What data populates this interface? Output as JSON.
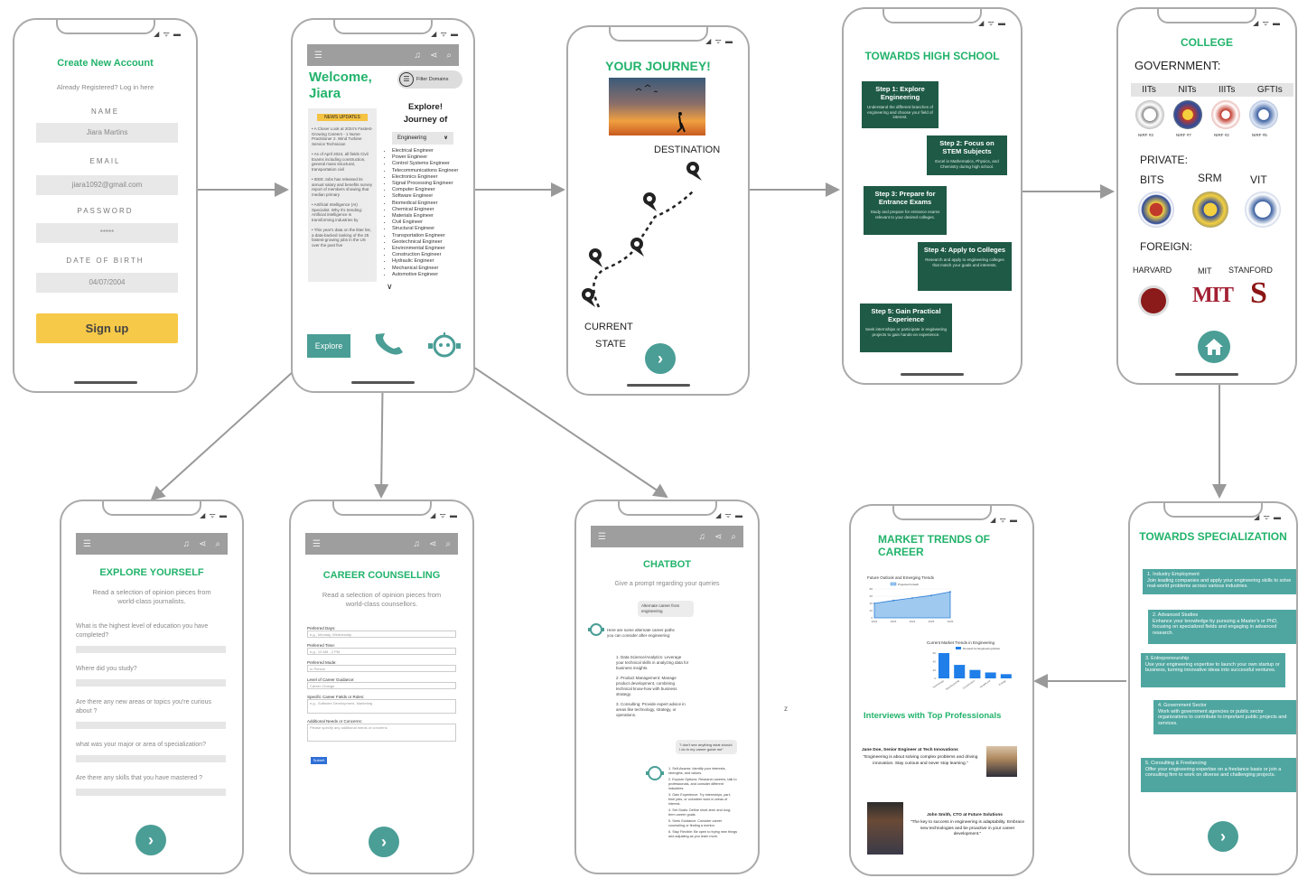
{
  "status_icons": "◢ ᯤ ▬",
  "signup": {
    "title": "Create New Account",
    "subtitle": "Already Registered? Log in here",
    "name_label": "NAME",
    "name_value": "Jiara Martins",
    "email_label": "EMAIL",
    "email_value": "jiara1092@gmail.com",
    "password_label": "PASSWORD",
    "password_value": "*****",
    "dob_label": "DATE OF BIRTH",
    "dob_value": "04/07/2004",
    "button": "Sign up"
  },
  "home": {
    "welcome": "Welcome,",
    "user": "Jiara",
    "filter_label": "Filter Domains",
    "news_header": "NEWS UPDATES",
    "news": [
      "A Closer Look at 2024's Fastest-Growing Careers - 1 Nurse Practitioner 2. Wind Turbine Service Technician",
      "As of April 2024, all fields Civil Exams including construction, general mass structural, transportation civil",
      "IEEE Jobs has released its annual salary and benefits survey report of members showing that median primary",
      "Artificial Intelligence (AI) Specialist. Why it's trending: Artificial intelligence is transforming industries by",
      "This year's data on the litter list, a data-backed ranking of the 25 fastest-growing jobs in the US over the past five"
    ],
    "explore_title": "Explore! Journey of",
    "dropdown_value": "Engineering",
    "engineering": [
      "Electrical Engineer",
      "Power Engineer",
      "Control Systems Engineer",
      "Telecommunications Engineer",
      "Electronics Engineer",
      "Signal Processing Engineer",
      "Computer Engineer",
      "Software Engineer",
      "Biomedical Engineer",
      "Chemical Engineer",
      "Materials Engineer",
      "Civil Engineer",
      "Structural Engineer",
      "Transportation Engineer",
      "Geotechnical Engineer",
      "Environmental Engineer",
      "Construction Engineer",
      "Hydraulic Engineer",
      "Mechanical Engineer",
      "Automotive Engineer"
    ],
    "explore_button": "Explore"
  },
  "journey": {
    "title": "YOUR JOURNEY!",
    "destination": "DESTINATION",
    "current1": "CURRENT",
    "current2": "STATE"
  },
  "highschool": {
    "title": "TOWARDS HIGH SCHOOL",
    "steps": [
      {
        "t": "Step 1: Explore Engineering",
        "d": "Understand the different branches of engineering and choose your field of interest."
      },
      {
        "t": "Step 2: Focus on STEM Subjects",
        "d": "Excel in Mathematics, Physics, and Chemistry during high school."
      },
      {
        "t": "Step 3: Prepare for Entrance Exams",
        "d": "Study and prepare for entrance exams relevant to your desired colleges."
      },
      {
        "t": "Step 4: Apply to Colleges",
        "d": "Research and apply to engineering colleges that match your goals and interests."
      },
      {
        "t": "Step 5: Gain Practical Experience",
        "d": "Seek internships or participate in engineering projects to gain hands-on experience."
      }
    ]
  },
  "college": {
    "title": "COLLEGE",
    "gov_label": "GOVERNMENT:",
    "gov_tabs": [
      "IITs",
      "NITs",
      "IIITs",
      "GFTIs"
    ],
    "nirf": [
      "NIRF #3",
      "NIRF #7",
      "NIRF #2",
      "NIRF #5"
    ],
    "private_label": "PRIVATE:",
    "private": [
      "BITS",
      "SRM",
      "VIT"
    ],
    "foreign_label": "FOREIGN:",
    "foreign": [
      "HARVARD",
      "MIT",
      "STANFORD"
    ],
    "mit_logo": "MIT",
    "stanford_logo": "S"
  },
  "explore_yourself": {
    "title": "EXPLORE YOURSELF",
    "subtitle": "Read a selection of opinion pieces from world-class journalists.",
    "questions": [
      "What is the highest level of education you have completed?",
      "Where did you study?",
      "Are there any new areas or topics you're curious about ?",
      "what was your major or area of specialization?",
      "Are there any skills that you have mastered ?"
    ]
  },
  "counselling": {
    "title": "CAREER COUNSELLING",
    "subtitle": "Read a selection of opinion pieces from world-class counsellors.",
    "fields": [
      {
        "label": "Preferred Days:",
        "value": "e.g., Monday, Wednesday"
      },
      {
        "label": "Preferred Time:",
        "value": "e.g., 10 AM - 2 PM"
      },
      {
        "label": "Preferred Mode:",
        "value": "In Person"
      },
      {
        "label": "Level of Career Guidance:",
        "value": "Career Change"
      },
      {
        "label": "Specific Career Fields or Roles:",
        "value": "e.g., Software Development, Marketing"
      },
      {
        "label": "Additional Needs or Concerns:",
        "value": "Please specify any additional needs or concerns"
      }
    ],
    "submit": "Submit"
  },
  "chatbot": {
    "title": "CHATBOT",
    "subtitle": "Give a prompt regarding your queries",
    "user_msg1": "Alternate career from engineering",
    "bot_intro": "Here are some alternate career paths you can consider after engineering:",
    "bot_items": [
      "1. Data Science/Analytics: Leverage your technical skills in analyzing data for business insights.",
      "2. Product Management: Manage product development, combining technical know-how with business strategy.",
      "3. Consulting: Provide expert advice in areas like technology, strategy, or operations."
    ],
    "user_msg2": "\"I don't see anything what should I do in my career guide me\"",
    "bot_items2": [
      "1. Self-Assess: Identify your interests, strengths, and values.",
      "2. Explore Options: Research careers, talk to professionals, and consider different industries.",
      "3. Gain Experience: Try internships, part-time jobs, or volunteer work in areas of interest.",
      "4. Set Goals: Define short-term and long-term career goals.",
      "5. Seek Guidance: Consider career counseling or finding a mentor.",
      "6. Stay Flexible: Be open to trying new things and adjusting as you learn more."
    ]
  },
  "market": {
    "title": "MARKET TRENDS OF CAREER",
    "chart1_title": "Future Outlook and Emerging Trends",
    "chart1_legend": "Projected Growth",
    "chart2_title": "Current Market Trends in Engineering",
    "chart2_legend": "Demand for Engineering Roles",
    "interviews_title": "Interviews with Top Professionals",
    "jane_name": "Jane Doe, Senior Engineer at Tech Innovations",
    "jane_quote": "\"Engineering is about solving complex problems and driving innovation. Stay curious and never stop learning.\"",
    "john_name": "John Smith, CTO at Future Solutions",
    "john_quote": "\"The key to success in engineering is adaptability. Embrace new technologies and be proactive in your career development.\""
  },
  "chart_data": [
    {
      "type": "area",
      "title": "Future Outlook and Emerging Trends",
      "series": [
        {
          "name": "Projected Growth",
          "values": [
            40,
            48,
            55,
            62,
            72
          ]
        }
      ],
      "x": [
        "2022",
        "2023",
        "2024",
        "2025",
        "2026"
      ],
      "ylim": [
        0,
        80
      ]
    },
    {
      "type": "bar",
      "title": "Current Market Trends in Engineering",
      "categories": [
        "Technology",
        "Manufacturing",
        "Construction",
        "Healthcare",
        "Energy"
      ],
      "series": [
        {
          "name": "Demand for Engineering Roles",
          "values": [
            60,
            32,
            20,
            14,
            10
          ]
        }
      ],
      "ylim": [
        0,
        60
      ]
    }
  ],
  "specialization": {
    "title": "TOWARDS SPECIALIZATION",
    "items": [
      {
        "t": "1. Industry Employment",
        "d": "Join leading companies and apply your engineering skills to solve real-world problems across various industries."
      },
      {
        "t": "2. Advanced Studies",
        "d": "Enhance your knowledge by pursuing a Master's or PhD, focusing on specialized fields and engaging in advanced research."
      },
      {
        "t": "3. Entrepreneurship",
        "d": "Use your engineering expertise to launch your own startup or business, turning innovative ideas into successful ventures."
      },
      {
        "t": "4. Government Sector",
        "d": "Work with government agencies or public sector organizations to contribute to important public projects and services."
      },
      {
        "t": "5. Consulting & Freelancing",
        "d": "Offer your engineering expertise on a freelance basis or join a consulting firm to work on diverse and challenging projects."
      }
    ]
  },
  "stray_mark": "z",
  "colors": {
    "accent_green": "#22b36b",
    "teal": "#4a9e96",
    "step_green": "#1f5a46",
    "spec_teal": "#4fa6a0",
    "signup_yellow": "#f7c948",
    "appbar_gray": "#9e9e9e"
  }
}
